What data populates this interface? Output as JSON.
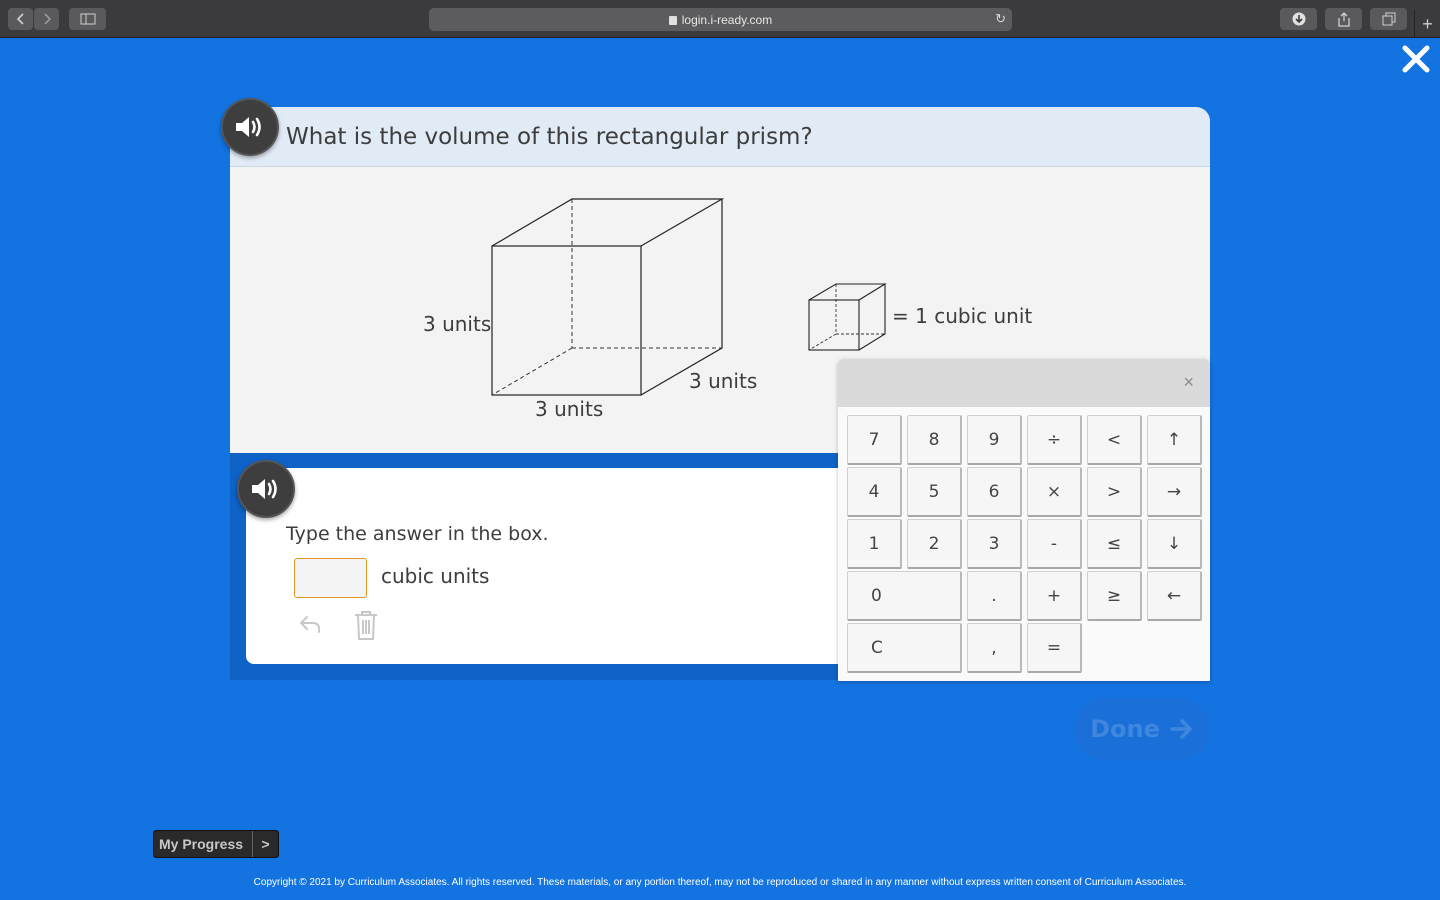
{
  "browser": {
    "url": "login.i-ready.com"
  },
  "question": {
    "text": "What is the volume of this rectangular prism?",
    "labels": {
      "height": "3 units",
      "width": "3 units",
      "depth": "3 units",
      "unit_legend": "= 1 cubic unit"
    }
  },
  "answer": {
    "prompt": "Type the answer in the box.",
    "value": "",
    "unit": "cubic units"
  },
  "keypad": {
    "close_label": "×",
    "keys": {
      "k7": "7",
      "k8": "8",
      "k9": "9",
      "div": "÷",
      "lt": "<",
      "up": "↑",
      "k4": "4",
      "k5": "5",
      "k6": "6",
      "mul": "×",
      "gt": ">",
      "right": "→",
      "k1": "1",
      "k2": "2",
      "k3": "3",
      "minus": "-",
      "le": "≤",
      "down": "↓",
      "k0": "0",
      "dot": ".",
      "plus": "+",
      "ge": "≥",
      "left": "←",
      "clear": "C",
      "comma": ",",
      "eq": "="
    }
  },
  "done": {
    "label": "Done"
  },
  "progress": {
    "label": "My Progress",
    "arrow": ">"
  },
  "footer": {
    "copyright": "Copyright © 2021 by Curriculum Associates. All rights reserved. These materials, or any portion thereof, may not be reproduced or shared in any manner without express written consent of Curriculum Associates."
  },
  "colors": {
    "background": "#1373e0",
    "answer_border": "#e39622",
    "header": "#e1ebf6"
  }
}
